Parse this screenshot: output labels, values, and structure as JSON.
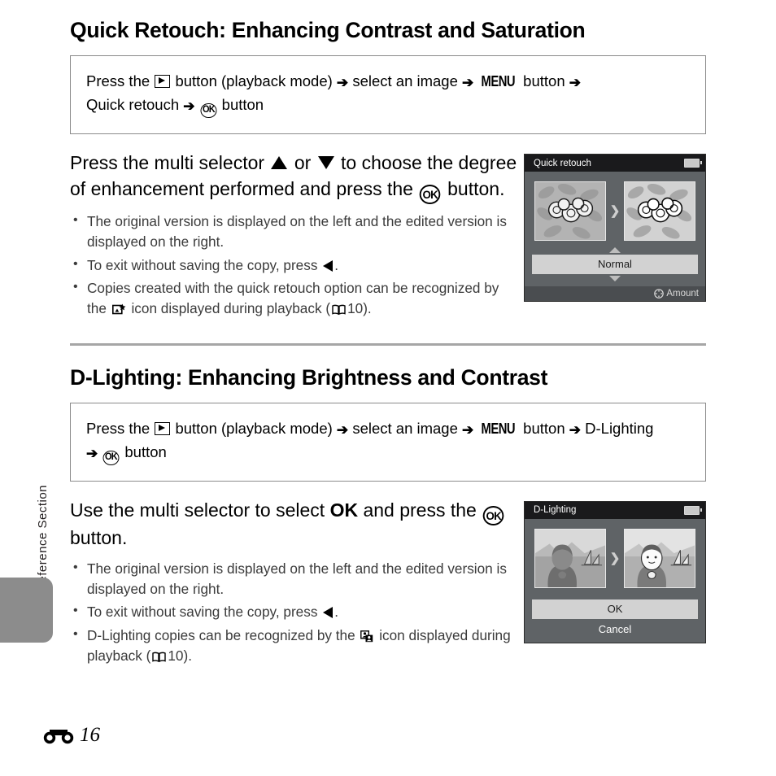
{
  "page": {
    "side_label": "Reference Section",
    "page_number": "16",
    "ref_symbol_name": "reference-section-binocular-symbol"
  },
  "sections": [
    {
      "id": "quick-retouch",
      "title": "Quick Retouch: Enhancing Contrast and Saturation",
      "command": {
        "line1_a": "Press the",
        "line1_b": "button (playback mode)",
        "line1_c": "select an image",
        "line1_d": "button",
        "line2_a": "Quick retouch",
        "line2_b": "button",
        "menu_label": "MENU",
        "ok_label": "OK",
        "arrow": "➔"
      },
      "lead": {
        "a": "Press the multi selector",
        "b": "or",
        "c": "to choose the degree of enhancement performed and press the",
        "d": "button."
      },
      "bullets": [
        {
          "text": "The original version is displayed on the left and the edited version is displayed on the right."
        },
        {
          "text_a": "To exit without saving the copy, press",
          "text_b": "."
        },
        {
          "text_a": "Copies created with the quick retouch option can be recognized by the",
          "text_b": "icon displayed during playback (",
          "page_ref": "10",
          "text_c": ")."
        }
      ],
      "screen": {
        "title": "Quick retouch",
        "battery_icon": "battery-icon",
        "transition_icon": "chevron-right-icon",
        "selector_value": "Normal",
        "up_icon": "triangle-up-icon",
        "down_icon": "triangle-down-icon",
        "footer_label": "Amount",
        "footer_icon": "multi-selector-icon",
        "thumb_left_name": "original-flower-thumbnail",
        "thumb_right_name": "retouched-flower-thumbnail"
      }
    },
    {
      "id": "d-lighting",
      "title": "D-Lighting: Enhancing Brightness and Contrast",
      "command": {
        "line1_a": "Press the",
        "line1_b": "button (playback mode)",
        "line1_c": "select an image",
        "line1_d": "button",
        "line1_e": "D-Lighting",
        "line2_b": "button",
        "menu_label": "MENU",
        "ok_label": "OK",
        "arrow": "➔"
      },
      "lead": {
        "a": "Use the multi selector to select",
        "bold": "OK",
        "c": "and press the",
        "d": "button."
      },
      "bullets": [
        {
          "text": "The original version is displayed on the left and the edited version is displayed on the right."
        },
        {
          "text_a": "To exit without saving the copy, press",
          "text_b": "."
        },
        {
          "text_a": "D-Lighting copies can be recognized by the",
          "text_b": "icon displayed during playback (",
          "page_ref": "10",
          "text_c": ")."
        }
      ],
      "screen": {
        "title": "D-Lighting",
        "battery_icon": "battery-icon",
        "transition_icon": "chevron-right-icon",
        "ok_label": "OK",
        "cancel_label": "Cancel",
        "thumb_left_name": "original-portrait-thumbnail",
        "thumb_right_name": "dlighting-portrait-thumbnail"
      }
    }
  ],
  "colors": {
    "screen_bg": "#5f6366",
    "screen_title_bg": "#1a1a1c",
    "selection_bar": "#d2d2d2",
    "rule": "#a6a6a6",
    "tab": "#8c8c8c"
  }
}
